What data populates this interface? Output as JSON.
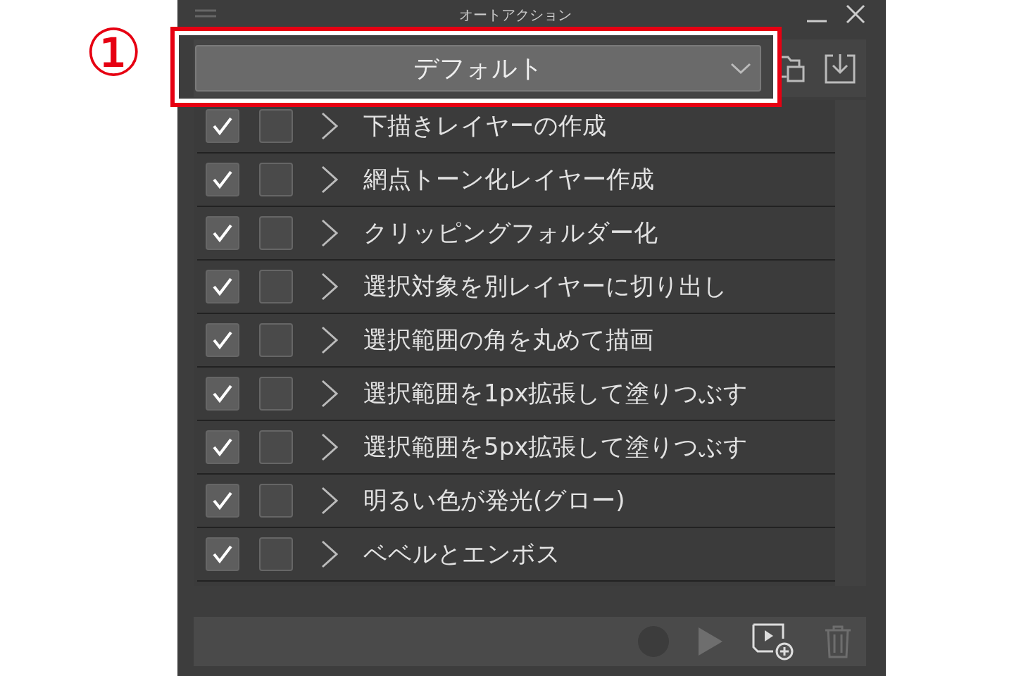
{
  "annotation": {
    "number": "①"
  },
  "window": {
    "title": "オートアクション"
  },
  "preset_dropdown": {
    "value": "デフォルト"
  },
  "actions": [
    {
      "label": "下描きレイヤーの作成",
      "checked": true,
      "dialog": false,
      "expanded": false
    },
    {
      "label": "網点トーン化レイヤー作成",
      "checked": true,
      "dialog": false,
      "expanded": false
    },
    {
      "label": "クリッピングフォルダー化",
      "checked": true,
      "dialog": false,
      "expanded": false
    },
    {
      "label": "選択対象を別レイヤーに切り出し",
      "checked": true,
      "dialog": false,
      "expanded": false
    },
    {
      "label": "選択範囲の角を丸めて描画",
      "checked": true,
      "dialog": false,
      "expanded": false
    },
    {
      "label": "選択範囲を1px拡張して塗りつぶす",
      "checked": true,
      "dialog": false,
      "expanded": false
    },
    {
      "label": "選択範囲を5px拡張して塗りつぶす",
      "checked": true,
      "dialog": false,
      "expanded": false
    },
    {
      "label": "明るい色が発光(グロー)",
      "checked": true,
      "dialog": false,
      "expanded": false
    },
    {
      "label": "ベベルとエンボス",
      "checked": true,
      "dialog": false,
      "expanded": false
    }
  ]
}
